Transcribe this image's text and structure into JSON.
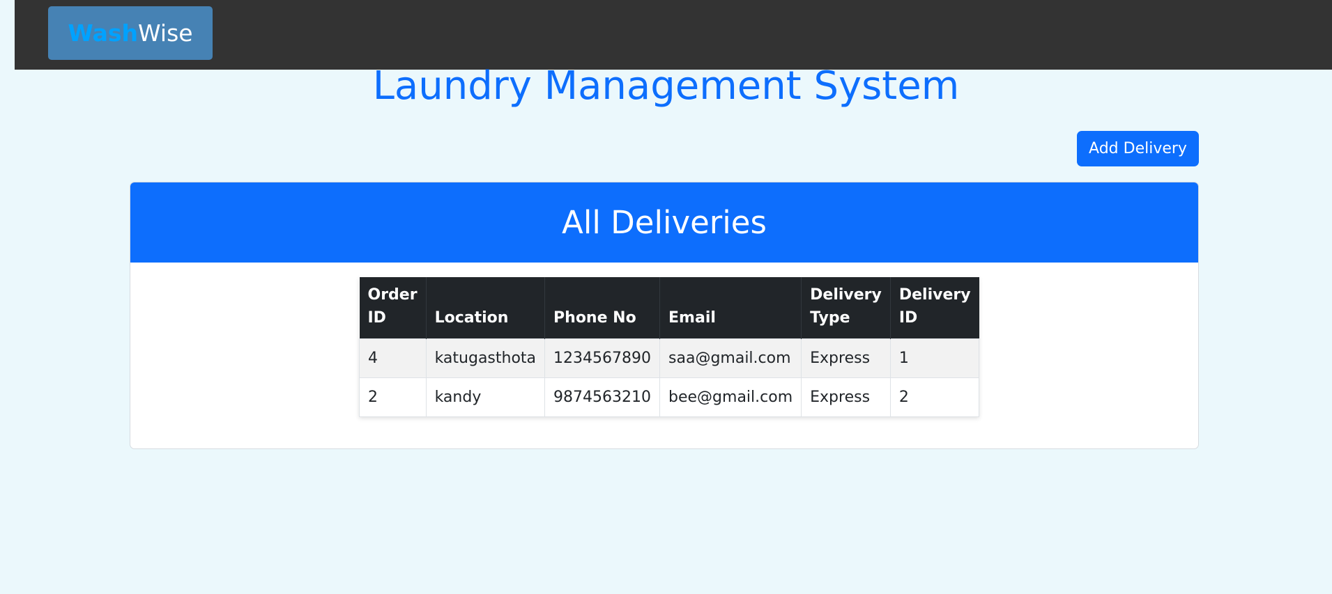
{
  "navbar": {
    "brand_part1": "Wash",
    "brand_part2": "Wise"
  },
  "page_title": "Laundry Management System",
  "add_button_label": "Add Delivery",
  "card": {
    "title": "All Deliveries"
  },
  "table": {
    "headers": [
      "Order ID",
      "Location",
      "Phone No",
      "Email",
      "Delivery Type",
      "Delivery ID"
    ],
    "rows": [
      [
        "4",
        "katugasthota",
        "1234567890",
        "saa@gmail.com",
        "Express",
        "1"
      ],
      [
        "2",
        "kandy",
        "9874563210",
        "bee@gmail.com",
        "Express",
        "2"
      ]
    ]
  },
  "colors": {
    "navbar_bg": "#333333",
    "brand_bg": "#4682b4",
    "brand_accent": "#00a2ff",
    "primary": "#0d6efd",
    "page_bg": "#ebf8fc",
    "table_header_bg": "#212529"
  }
}
